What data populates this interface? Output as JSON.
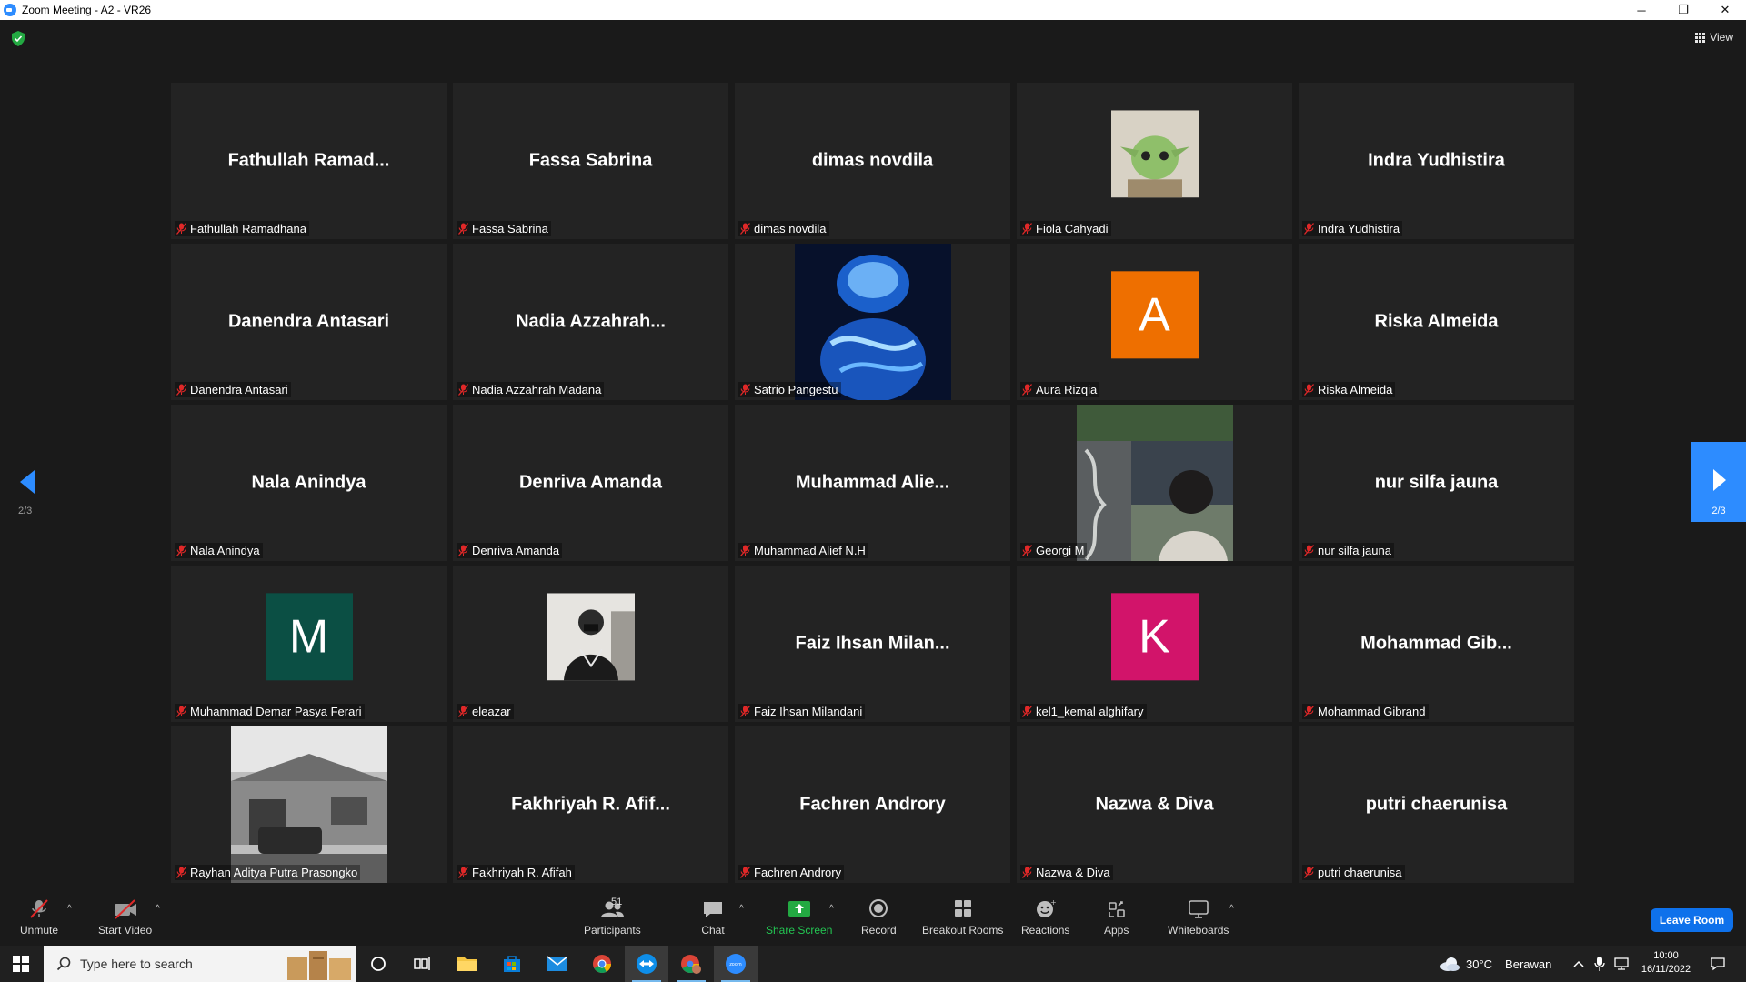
{
  "window": {
    "title": "Zoom Meeting - A2 - VR26",
    "minimize": "─",
    "restore": "❐",
    "close": "✕"
  },
  "header": {
    "view_label": "View"
  },
  "pagination": {
    "left_page": "2/3",
    "right_page": "2/3"
  },
  "colors": {
    "accent": "#2d8cff",
    "avatar_orange": "#ee6f00",
    "avatar_green": "#0b4f44",
    "avatar_pink": "#d2146a",
    "mic_muted": "#e02828"
  },
  "tiles": [
    {
      "name": "Fathullah  Ramad...",
      "label": "Fathullah Ramadhana",
      "type": "name"
    },
    {
      "name": "Fassa Sabrina",
      "label": "Fassa Sabrina",
      "type": "name"
    },
    {
      "name": "dimas novdila",
      "label": "dimas novdila",
      "type": "name"
    },
    {
      "name": "",
      "label": "Fiola Cahyadi",
      "type": "avatar-image"
    },
    {
      "name": "Indra Yudhistira",
      "label": "Indra Yudhistira",
      "type": "name"
    },
    {
      "name": "Danendra Antasari",
      "label": "Danendra Antasari",
      "type": "name"
    },
    {
      "name": "Nadia  Azzahrah...",
      "label": "Nadia Azzahrah Madana",
      "type": "name"
    },
    {
      "name": "",
      "label": "Satrio Pangestu",
      "type": "video"
    },
    {
      "name": "A",
      "label": "Aura Rizqia",
      "type": "avatar-letter",
      "color": "#ee6f00"
    },
    {
      "name": "Riska Almeida",
      "label": "Riska Almeida",
      "type": "name"
    },
    {
      "name": "Nala Anindya",
      "label": "Nala Anindya",
      "type": "name"
    },
    {
      "name": "Denriva Amanda",
      "label": "Denriva Amanda",
      "type": "name"
    },
    {
      "name": "Muhammad  Alie...",
      "label": "Muhammad Alief N.H",
      "type": "name"
    },
    {
      "name": "",
      "label": "Georgi M",
      "type": "video"
    },
    {
      "name": "nur silfa jauna",
      "label": "nur silfa jauna",
      "type": "name"
    },
    {
      "name": "M",
      "label": "Muhammad Demar Pasya Ferari",
      "type": "avatar-letter",
      "color": "#0b4f44"
    },
    {
      "name": "",
      "label": "eleazar",
      "type": "avatar-image"
    },
    {
      "name": "Faiz  Ihsan  Milan...",
      "label": "Faiz Ihsan Milandani",
      "type": "name"
    },
    {
      "name": "K",
      "label": "kel1_kemal alghifary",
      "type": "avatar-letter",
      "color": "#d2146a"
    },
    {
      "name": "Mohammad  Gib...",
      "label": "Mohammad Gibrand",
      "type": "name"
    },
    {
      "name": "",
      "label": "Rayhan Aditya Putra Prasongko",
      "type": "video"
    },
    {
      "name": "Fakhriyah  R.  Afif...",
      "label": "Fakhriyah R. Afifah",
      "type": "name"
    },
    {
      "name": "Fachren Androry",
      "label": "Fachren Androry",
      "type": "name"
    },
    {
      "name": "Nazwa & Diva",
      "label": "Nazwa & Diva",
      "type": "name"
    },
    {
      "name": "putri chaerunisa",
      "label": "putri chaerunisa",
      "type": "name"
    }
  ],
  "toolbar": {
    "unmute": "Unmute",
    "start_video": "Start Video",
    "participants": "Participants",
    "participants_count": "51",
    "chat": "Chat",
    "share_screen": "Share Screen",
    "record": "Record",
    "breakout_rooms": "Breakout Rooms",
    "reactions": "Reactions",
    "apps": "Apps",
    "whiteboards": "Whiteboards",
    "leave_room": "Leave Room",
    "caret": "^"
  },
  "taskbar": {
    "search_placeholder": "Type here to search",
    "weather_temp": "30°C",
    "weather_text": "Berawan",
    "time": "10:00",
    "date": "16/11/2022"
  }
}
